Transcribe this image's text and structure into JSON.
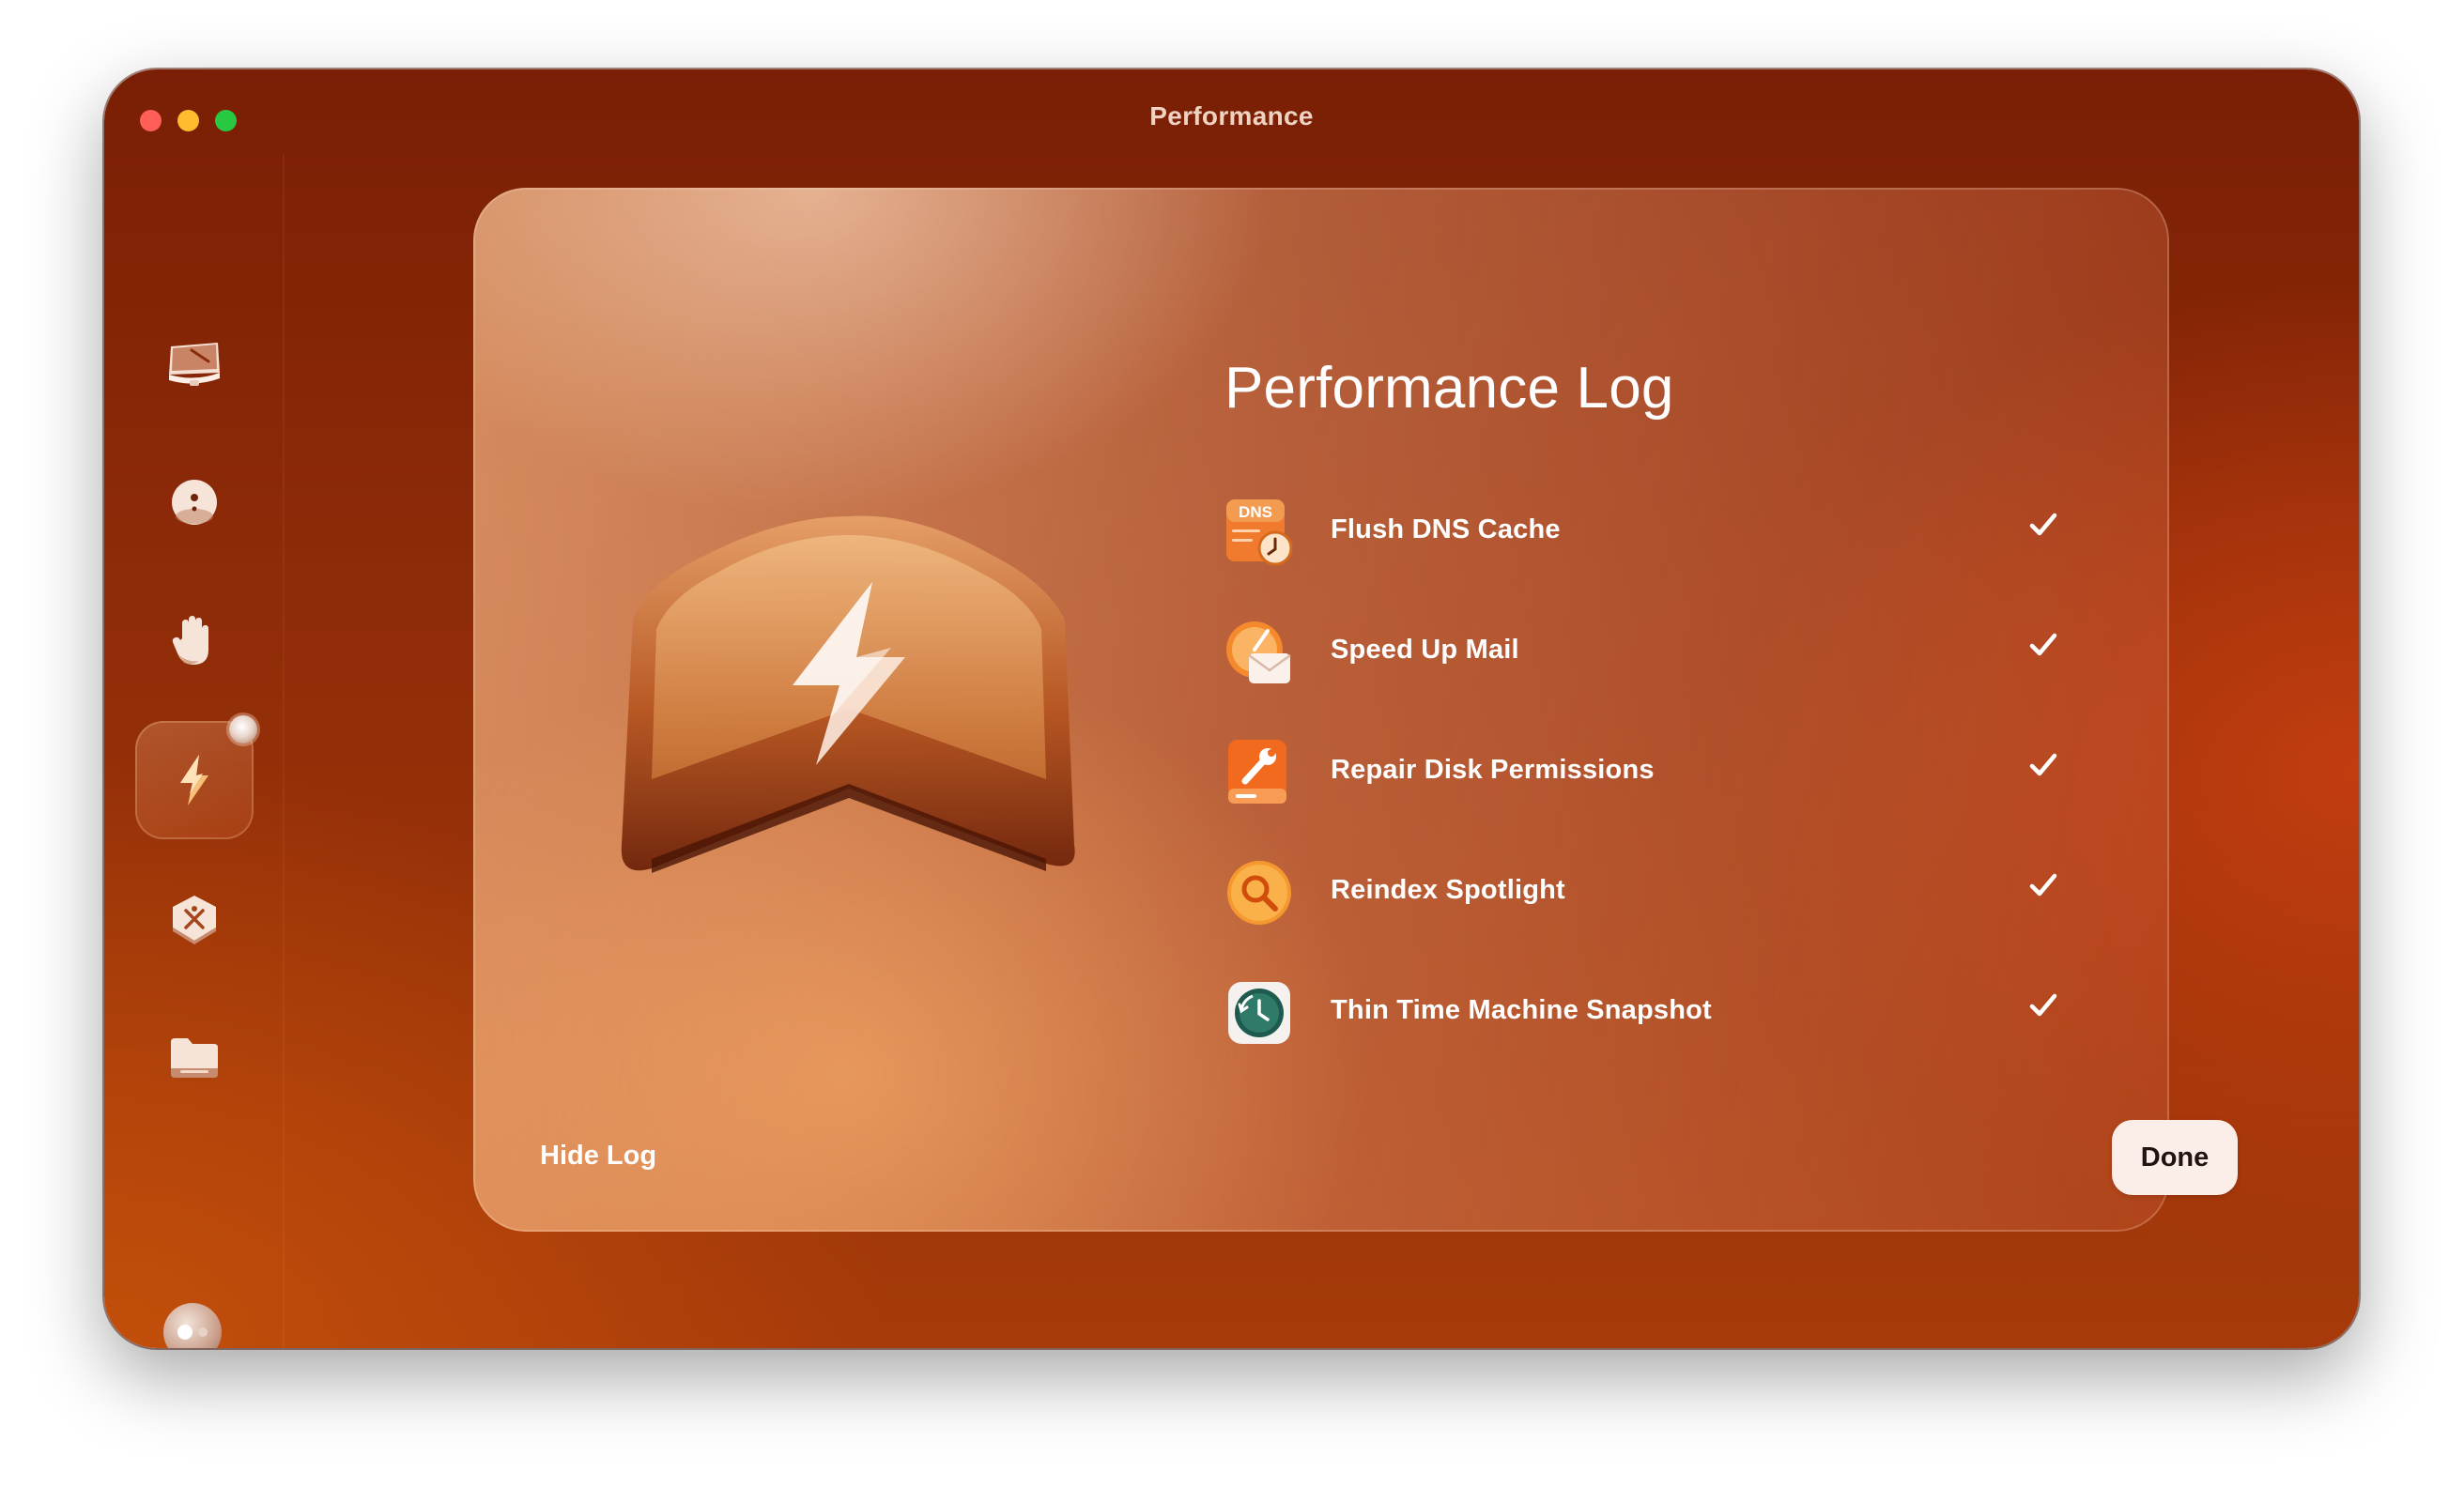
{
  "window": {
    "title": "Performance"
  },
  "sidebar": {
    "items": [
      {
        "name": "smart-care",
        "icon": "monitor-sweep-icon",
        "active": false
      },
      {
        "name": "cleanup",
        "icon": "broom-ball-icon",
        "active": false
      },
      {
        "name": "protection",
        "icon": "hand-icon",
        "active": true,
        "active_index_note": ""
      },
      {
        "name": "performance",
        "icon": "lightning-icon",
        "active": true
      },
      {
        "name": "applications",
        "icon": "apps-icon",
        "active": false
      },
      {
        "name": "my-clutter",
        "icon": "folder-icon",
        "active": false
      }
    ]
  },
  "log": {
    "title": "Performance Log",
    "items": [
      {
        "label": "Flush DNS Cache",
        "icon": "dns-clock-icon",
        "done": true,
        "icon_badge": "DNS"
      },
      {
        "label": "Speed Up Mail",
        "icon": "mail-speed-icon",
        "done": true
      },
      {
        "label": "Repair Disk Permissions",
        "icon": "disk-wrench-icon",
        "done": true
      },
      {
        "label": "Reindex Spotlight",
        "icon": "spotlight-icon",
        "done": true
      },
      {
        "label": "Thin Time Machine Snapshot",
        "icon": "time-machine-icon",
        "done": true
      }
    ]
  },
  "footer": {
    "hide_log": "Hide Log",
    "done": "Done"
  },
  "colors": {
    "window_base": "#8e2b08",
    "accent_orange": "#f08a24",
    "done_button_bg": "#fbeee8"
  }
}
